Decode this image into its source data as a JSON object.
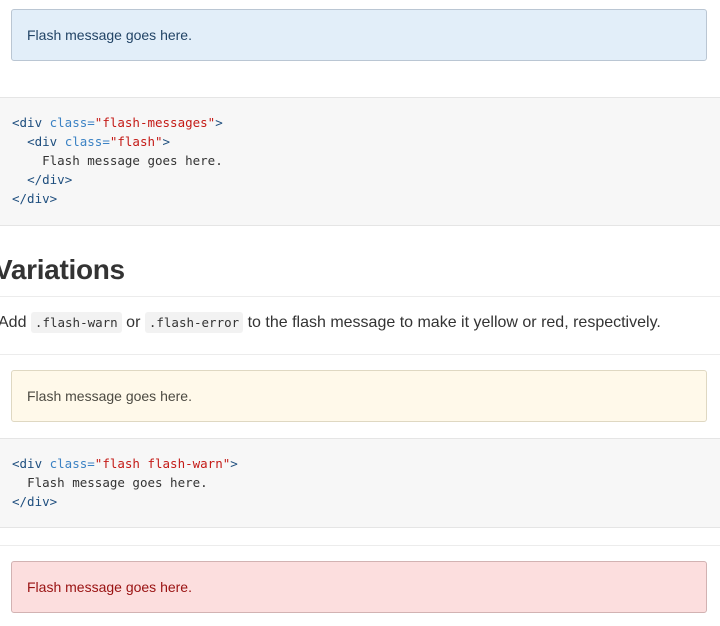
{
  "flash_info": {
    "text": "Flash message goes here."
  },
  "code_example_1": {
    "l1_tag_open": "<div",
    "l1_attr": " class=",
    "l1_value": "\"flash-messages\"",
    "l1_tag_close": ">",
    "l2_tag_open": "<div",
    "l2_attr": " class=",
    "l2_value": "\"flash\"",
    "l2_tag_close": ">",
    "l3_text": "Flash message goes here.",
    "l4_tag": "</div>",
    "l5_tag": "</div>"
  },
  "variations": {
    "heading": "Variations",
    "desc_prefix": "Add ",
    "desc_code_warn": ".flash-warn",
    "desc_middle": " or ",
    "desc_code_error": ".flash-error",
    "desc_suffix": " to the flash message to make it yellow or red, respectively."
  },
  "flash_warn": {
    "text": "Flash message goes here."
  },
  "code_example_2": {
    "l1_tag_open": "<div",
    "l1_attr": " class=",
    "l1_value": "\"flash flash-warn\"",
    "l1_tag_close": ">",
    "l2_text": "Flash message goes here.",
    "l3_tag": "</div>"
  },
  "flash_error": {
    "text": "Flash message goes here."
  },
  "colors": {
    "info_bg": "#e2eef9",
    "warn_bg": "#fff9ea",
    "error_bg": "#fcdede",
    "code_bg": "#f7f7f7"
  }
}
